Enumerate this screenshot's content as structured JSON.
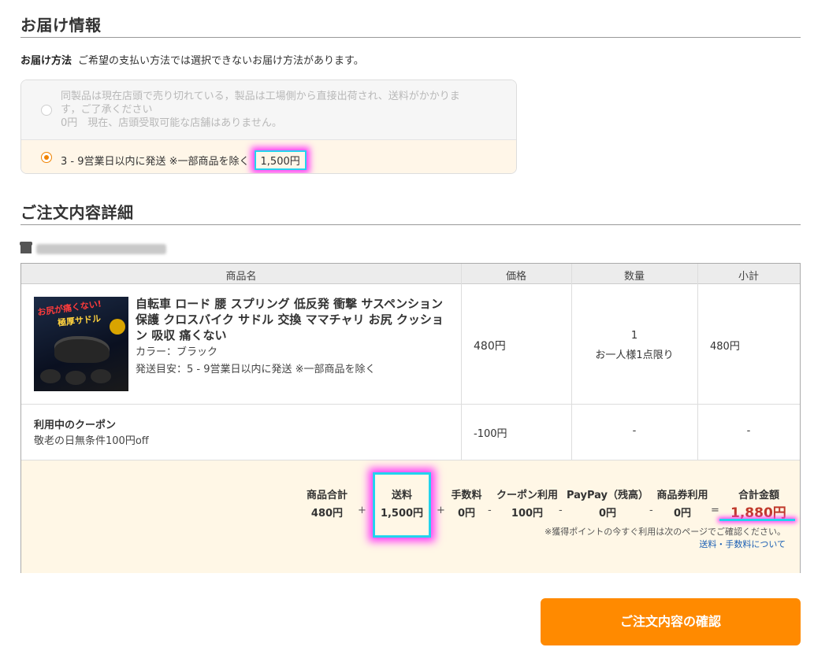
{
  "delivery": {
    "title": "お届け情報",
    "method_label": "お届け方法",
    "method_note": "ご希望の支払い方法では選択できないお届け方法があります。",
    "options": [
      {
        "line1": "同製品は現在店頭で売り切れている，製品は工場側から直接出荷され、送料がかかりま",
        "line2": "す，ご了承ください",
        "line3": "0円　現在、店頭受取可能な店舗はありません。",
        "selected": false
      },
      {
        "text": "3 - 9営業日以内に発送 ※一部商品を除く",
        "price": "1,500円",
        "selected": true
      }
    ]
  },
  "order": {
    "title": "ご注文内容詳細",
    "headers": [
      "商品名",
      "価格",
      "数量",
      "小計"
    ],
    "product": {
      "title": "自転車 ロード 腰 スプリング 低反発 衝撃 サスペンション 保護 クロスバイク サドル 交換 ママチャリ お尻 クッション 吸収 痛くない",
      "color": "カラー：ブラック",
      "shipping": "発送目安：5 - 9営業日以内に発送 ※一部商品を除く",
      "price": "480円",
      "qty": "1",
      "qty_limit": "お一人様1点限り",
      "subtotal": "480円",
      "image_text_1": "お尻が痛くない!",
      "image_text_2": "極厚サドル"
    },
    "coupon": {
      "label": "利用中のクーポン",
      "name": "敬老の日無条件100円off",
      "price": "-100円",
      "qty": "-",
      "subtotal": "-"
    }
  },
  "summary": {
    "items": [
      {
        "label": "商品合計",
        "value": "480円"
      },
      {
        "label": "送料",
        "value": "1,500円"
      },
      {
        "label": "手数料",
        "value": "0円"
      },
      {
        "label": "クーポン利用",
        "value": "100円"
      },
      {
        "label": "PayPay（残高）",
        "value": "0円"
      },
      {
        "label": "商品券利用",
        "value": "0円"
      },
      {
        "label": "合計金額",
        "value": "1,880円"
      }
    ],
    "ops": [
      "+",
      "+",
      "-",
      "-",
      "-",
      "="
    ],
    "note": "※獲得ポイントの今すぐ利用は次のページでご確認ください。",
    "link": "送料・手数料について"
  },
  "confirm_button": "ご注文内容の確認",
  "colors": {
    "accent": "#ff8a00",
    "radio": "#f08300",
    "total": "#c0392b",
    "link": "#1a5fb4",
    "highlight_border": "#22d3ee",
    "highlight_glow": "#ff3df8"
  }
}
